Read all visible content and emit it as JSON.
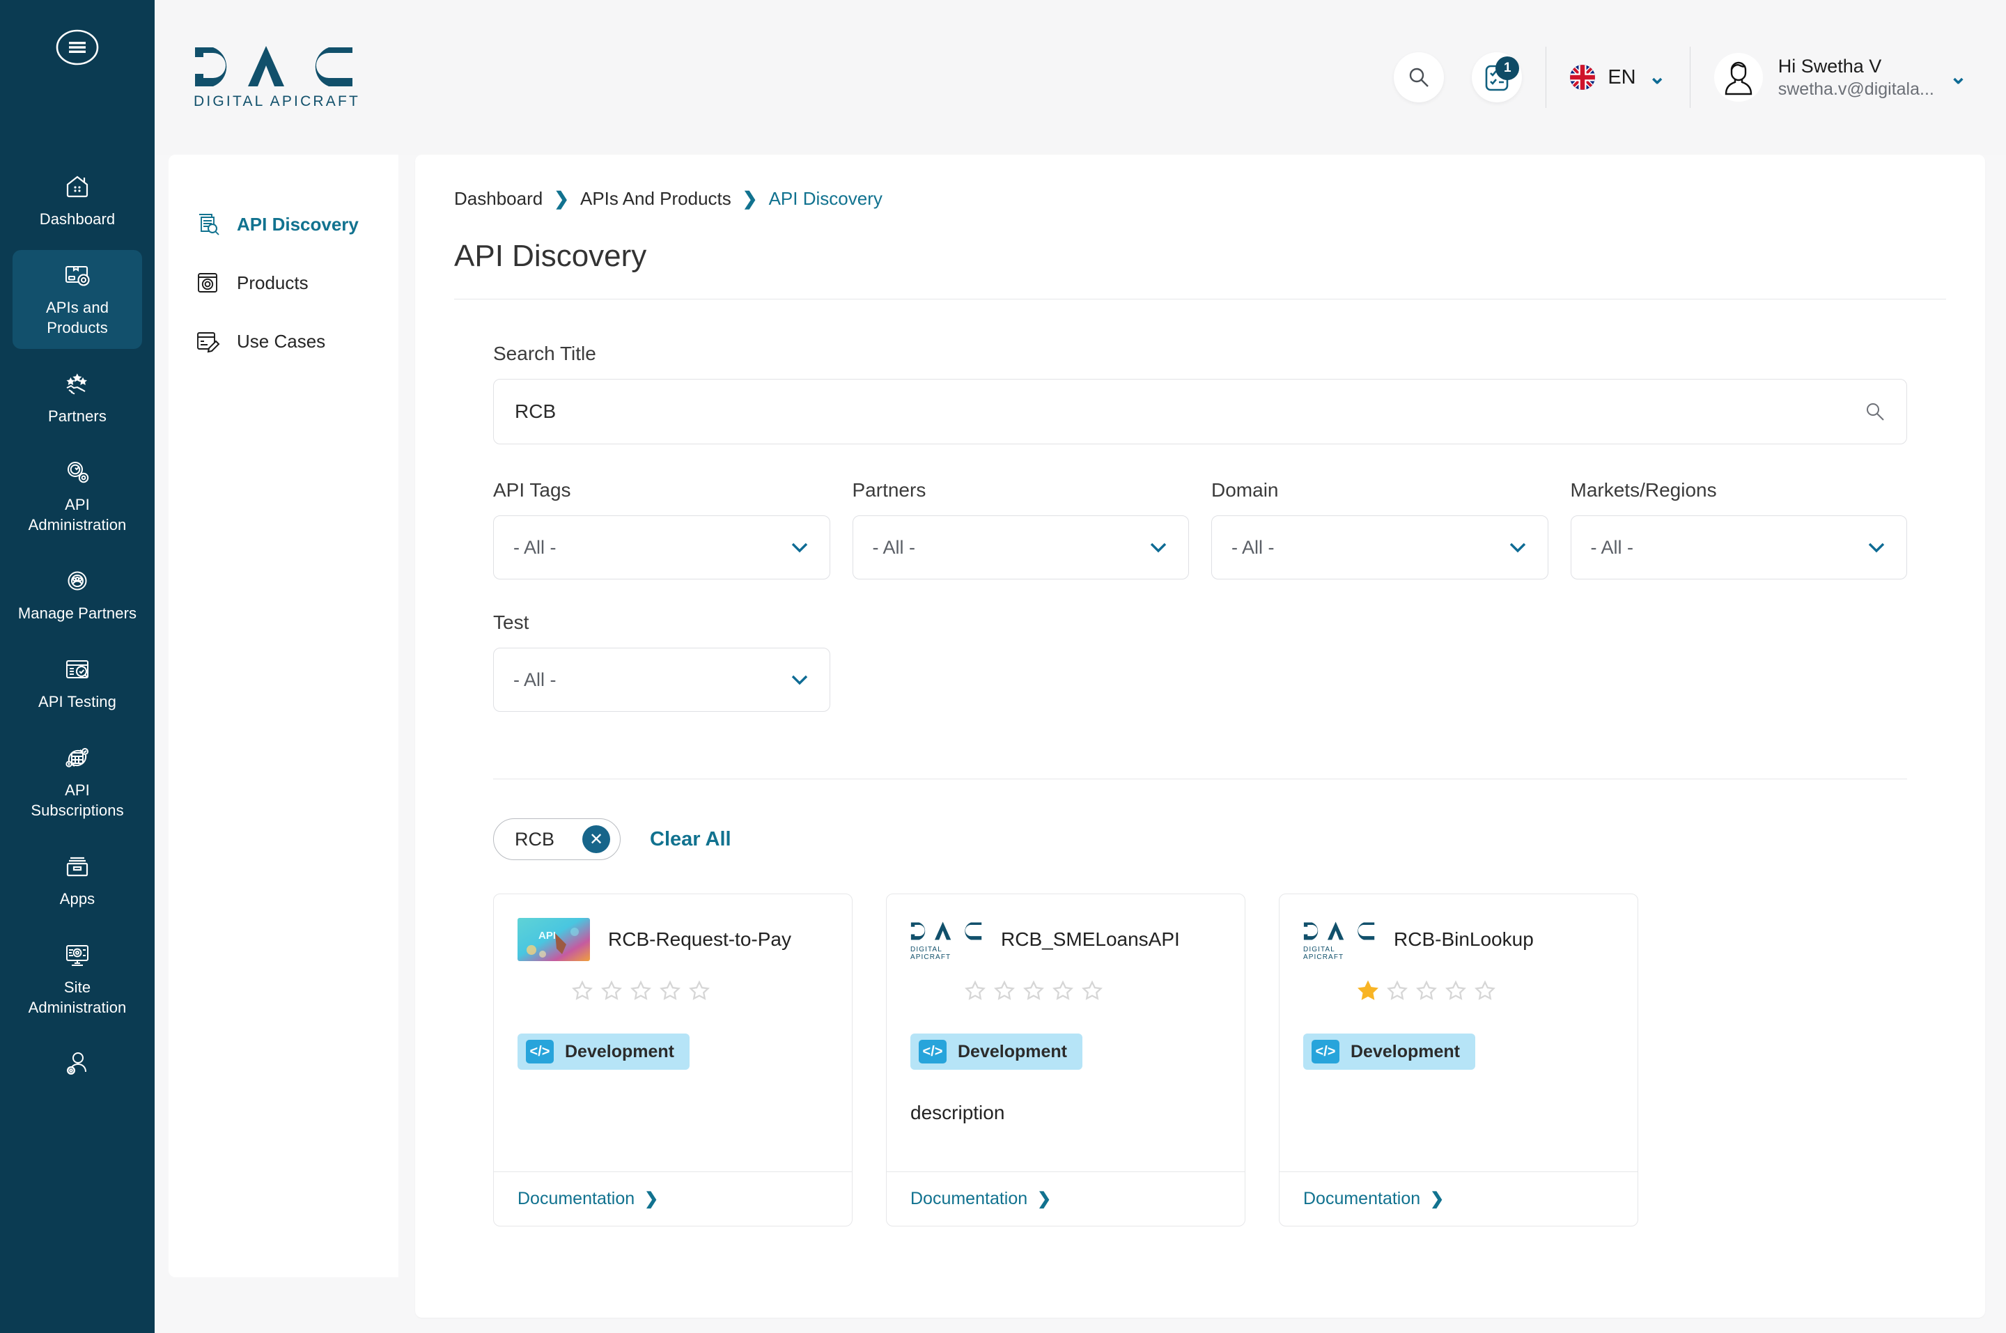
{
  "brand": {
    "logo_text": "DAC",
    "logo_sub": "DIGITAL APICRAFT",
    "accent": "#11728f",
    "rail_bg": "#0b3b52",
    "rail_active_bg": "#12506c"
  },
  "rail": {
    "menu_icon": "hamburger-icon",
    "items": [
      {
        "label": "Dashboard",
        "icon": "dashboard-icon",
        "active": false
      },
      {
        "label": "APIs and Products",
        "icon": "apis-products-icon",
        "active": true
      },
      {
        "label": "Partners",
        "icon": "partners-handshake-icon",
        "active": false
      },
      {
        "label": "API Administration",
        "icon": "api-administration-gear-icon",
        "active": false
      },
      {
        "label": "Manage Partners",
        "icon": "manage-partners-icon",
        "active": false
      },
      {
        "label": "API Testing",
        "icon": "api-testing-icon",
        "active": false
      },
      {
        "label": "API Subscriptions",
        "icon": "api-subscriptions-icon",
        "active": false
      },
      {
        "label": "Apps",
        "icon": "apps-archive-icon",
        "active": false
      },
      {
        "label": "Site Administration",
        "icon": "site-administration-icon",
        "active": false
      },
      {
        "label": "",
        "icon": "user-settings-icon",
        "active": false
      }
    ]
  },
  "topbar": {
    "search_icon": "search-icon",
    "notifications_icon": "tasklist-icon",
    "notifications_count": "1",
    "language": {
      "code": "EN",
      "flag": "uk-flag-icon"
    },
    "user": {
      "greeting": "Hi Swetha V",
      "email": "swetha.v@digitala...",
      "avatar_icon": "avatar-icon"
    }
  },
  "subnav": {
    "items": [
      {
        "label": "API Discovery",
        "icon": "api-discovery-icon",
        "active": true
      },
      {
        "label": "Products",
        "icon": "products-gear-icon",
        "active": false
      },
      {
        "label": "Use Cases",
        "icon": "use-cases-pencil-icon",
        "active": false
      }
    ]
  },
  "breadcrumb": {
    "items": [
      "Dashboard",
      "APIs And Products",
      "API Discovery"
    ],
    "separator": "❯"
  },
  "page": {
    "title": "API Discovery"
  },
  "search": {
    "label": "Search Title",
    "value": "RCB",
    "placeholder": "",
    "icon": "search-icon"
  },
  "filters": [
    {
      "label": "API Tags",
      "value": "- All -"
    },
    {
      "label": "Partners",
      "value": "- All -"
    },
    {
      "label": "Domain",
      "value": "- All -"
    },
    {
      "label": "Markets/Regions",
      "value": "- All -"
    },
    {
      "label": "Test",
      "value": "- All -"
    }
  ],
  "applied": {
    "chips": [
      {
        "text": "RCB",
        "remove_icon": "close-icon"
      }
    ],
    "clear_all_label": "Clear All"
  },
  "results": {
    "documentation_label": "Documentation",
    "cards": [
      {
        "title": "RCB-Request-to-Pay",
        "thumb": "api-photo-thumbnail",
        "rating": 0,
        "rating_max": 5,
        "tag": "Development",
        "tag_icon": "code-icon",
        "description": ""
      },
      {
        "title": "RCB_SMELoansAPI",
        "thumb": "dac-logo-thumbnail",
        "rating": 0,
        "rating_max": 5,
        "tag": "Development",
        "tag_icon": "code-icon",
        "description": "description"
      },
      {
        "title": "RCB-BinLookup",
        "thumb": "dac-logo-thumbnail",
        "rating": 1,
        "rating_max": 5,
        "tag": "Development",
        "tag_icon": "code-icon",
        "description": ""
      }
    ]
  }
}
